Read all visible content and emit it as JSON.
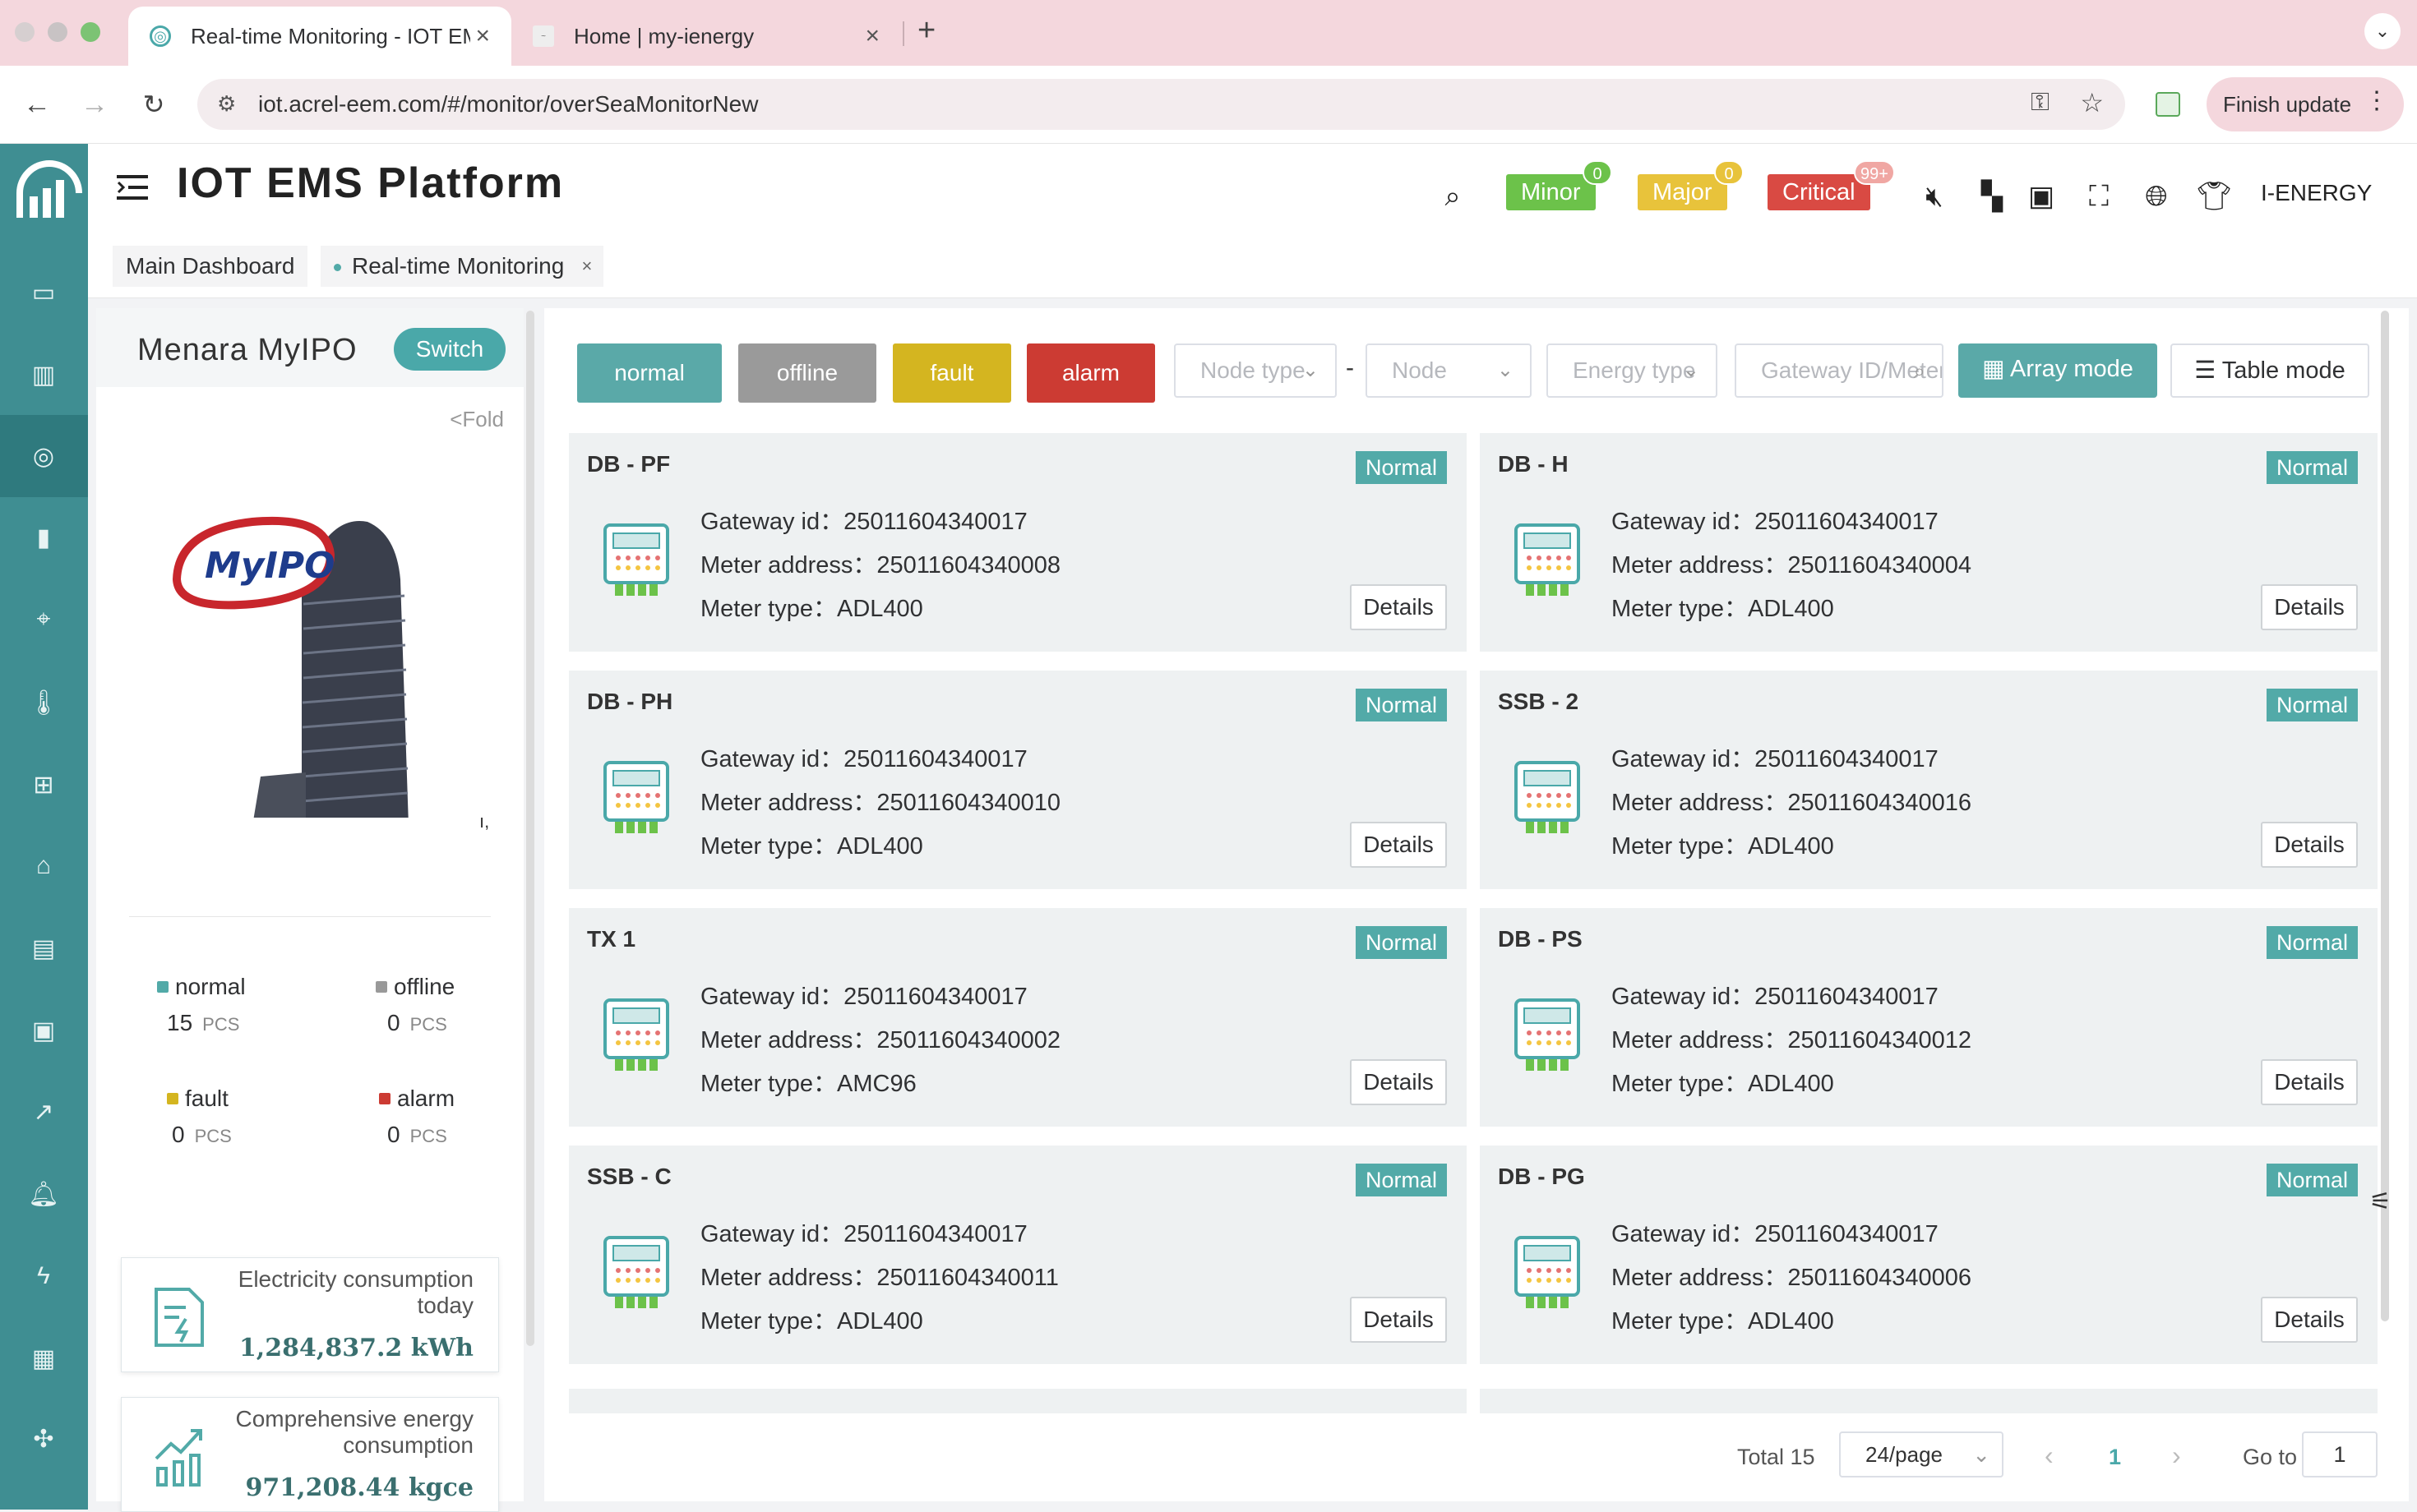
{
  "browser": {
    "tabs": [
      {
        "title": "Real-time Monitoring - IOT EMS",
        "active": true
      },
      {
        "title": "Home | my-ienergy",
        "active": false
      }
    ],
    "url": "iot.acrel-eem.com/#/monitor/overSeaMonitorNew",
    "finish_update": "Finish update"
  },
  "header": {
    "title": "IOT EMS Platform",
    "alarms": [
      {
        "label": "Minor",
        "count": "0",
        "color": "#6cc24a"
      },
      {
        "label": "Major",
        "count": "0",
        "color": "#e8c33b"
      },
      {
        "label": "Critical",
        "count": "99+",
        "color": "#d94a43"
      }
    ],
    "user": "I-ENERGY"
  },
  "tags": [
    "Main Dashboard",
    "Real-time Monitoring"
  ],
  "left_panel": {
    "site_name": "Menara MyIPO",
    "switch_label": "Switch",
    "fold_label": "<Fold",
    "logo_text": "MyIPO",
    "stats": [
      {
        "label": "normal",
        "value": "15",
        "unit": "PCS",
        "color": "#52aaa8"
      },
      {
        "label": "offline",
        "value": "0",
        "unit": "PCS",
        "color": "#999999"
      },
      {
        "label": "fault",
        "value": "0",
        "unit": "PCS",
        "color": "#d4b520"
      },
      {
        "label": "alarm",
        "value": "0",
        "unit": "PCS",
        "color": "#cc3b33"
      }
    ],
    "electricity": {
      "label": "Electricity consumption today",
      "value": "1,284,837.2 kWh"
    },
    "energy": {
      "label": "Comprehensive energy consumption",
      "value": "971,208.44 kgce"
    }
  },
  "filters": {
    "status_buttons": [
      {
        "label": "normal",
        "color": "#5aa9a8"
      },
      {
        "label": "offline",
        "color": "#9a9a9a"
      },
      {
        "label": "fault",
        "color": "#d4b520"
      },
      {
        "label": "alarm",
        "color": "#cc3b33"
      }
    ],
    "node_type_placeholder": "Node type",
    "node_placeholder": "Node",
    "energy_type_placeholder": "Energy type",
    "gateway_placeholder": "Gateway ID/Meter address",
    "array_mode": "Array mode",
    "table_mode": "Table mode"
  },
  "card_labels": {
    "gateway": "Gateway id：",
    "meter_address": "Meter address：",
    "meter_type": "Meter type：",
    "details": "Details"
  },
  "cards": [
    {
      "name": "DB - PF",
      "status": "Normal",
      "gateway": "25011604340017",
      "address": "25011604340008",
      "type": "ADL400"
    },
    {
      "name": "DB - H",
      "status": "Normal",
      "gateway": "25011604340017",
      "address": "25011604340004",
      "type": "ADL400"
    },
    {
      "name": "DB - PH",
      "status": "Normal",
      "gateway": "25011604340017",
      "address": "25011604340010",
      "type": "ADL400"
    },
    {
      "name": "SSB - 2",
      "status": "Normal",
      "gateway": "25011604340017",
      "address": "25011604340016",
      "type": "ADL400"
    },
    {
      "name": "TX 1",
      "status": "Normal",
      "gateway": "25011604340017",
      "address": "25011604340002",
      "type": "AMC96"
    },
    {
      "name": "DB - PS",
      "status": "Normal",
      "gateway": "25011604340017",
      "address": "25011604340012",
      "type": "ADL400"
    },
    {
      "name": "SSB - C",
      "status": "Normal",
      "gateway": "25011604340017",
      "address": "25011604340011",
      "type": "ADL400"
    },
    {
      "name": "DB - PG",
      "status": "Normal",
      "gateway": "25011604340017",
      "address": "25011604340006",
      "type": "ADL400"
    }
  ],
  "pagination": {
    "total": "Total 15",
    "page_size": "24/page",
    "current": "1",
    "goto_label": "Go to",
    "goto_value": "1"
  }
}
